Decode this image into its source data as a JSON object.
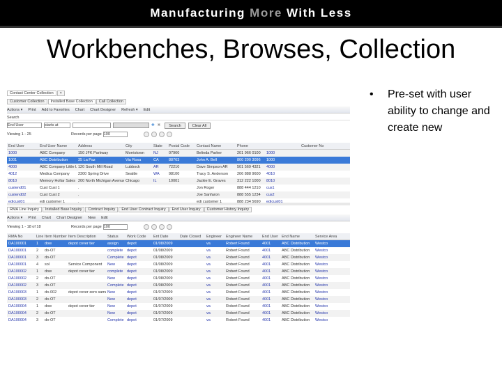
{
  "banner": {
    "part1": "Manufacturing ",
    "part2": "More",
    "part3": " With Less"
  },
  "title": "Workbenches, Browses, Collection",
  "bullet": "Pre-set with user ability to change and create new",
  "app": {
    "top_tab": "Contact Center Collection",
    "collection_tabs": [
      "Customer Collection",
      "Installed Base Collection",
      "Call Collection"
    ],
    "toolbar1": [
      "Actions ▾",
      "Print",
      "Add to Favorites",
      "Chart",
      "Chart Designer",
      "Refresh ▾",
      "Edit"
    ],
    "search_label": "Search",
    "search_field": "End User",
    "search_op": "starts at",
    "search_value": "",
    "search_button": "Search",
    "clear_button": "Clear All",
    "viewing1": "Viewing 1 - 25",
    "records_label": "Records per page",
    "records_value1": "100",
    "grid1": {
      "columns": [
        "End User",
        "End User Name",
        "Address",
        "City",
        "State",
        "Postal Code",
        "Contact Name",
        "Phone",
        "",
        "Customer No"
      ],
      "link_cols": [
        0,
        4,
        8
      ],
      "selected": 1,
      "rows": [
        [
          "1000",
          "ABC Company",
          "150 JFK Parkway",
          "Morristown",
          "NJ",
          "07960",
          "Belinda Parker",
          "201 966 0100",
          "1000",
          ""
        ],
        [
          "1001",
          "ABC Distribution",
          "35 La Paz",
          "Via Rosa",
          "CA",
          "88763",
          "John A. Bell",
          "800 200 3096",
          "1000",
          ""
        ],
        [
          "4000",
          "ABC Company Little Ltd.",
          "120 South Mill Road",
          "Lubbock",
          "AR",
          "72210",
          "Dave Simpson AR",
          "501 569 4321",
          "4000",
          ""
        ],
        [
          "4012",
          "Medica Company",
          "2300 Spring Drive",
          "Seattle",
          "WA",
          "98100",
          "Tracy S. Anderson",
          "206 888 9600",
          "4010",
          ""
        ],
        [
          "8010",
          "Memory Hollar Sales",
          "200 North Michigan Avenue",
          "Chicago",
          "IL",
          "10001",
          "Jackie E. Graves",
          "312 222 1000",
          "8010",
          ""
        ],
        [
          "custend01",
          "Cust Cust 1",
          ".",
          "",
          "",
          "",
          "Jon Roger",
          "888 444 1210",
          "cus1",
          ""
        ],
        [
          "custend02",
          "Cust Cust 2",
          ".",
          "",
          "",
          "",
          "Joe Sanfaron",
          "888 555 1234",
          "cus2",
          ""
        ],
        [
          "edicust01",
          "edi customer 1",
          ".",
          "",
          "",
          "",
          "edi customer 1",
          "888 234 5690",
          "edicust01",
          ""
        ]
      ]
    },
    "bottom_tabs": [
      "RMA Line Inquiry",
      "Installed Base Inquiry",
      "Contract Inquiry",
      "End User Contract Inquiry",
      "End User Inquiry",
      "Customer History Inquiry"
    ],
    "toolbar2": [
      "Actions ▾",
      "Print",
      "Chart",
      "Chart Designer",
      "New",
      "Edit"
    ],
    "viewing2": "Viewing 1 - 18 of 18",
    "records_value2": "100",
    "grid2": {
      "columns": [
        "RMA No",
        "Line",
        "Item Number",
        "Item Description",
        "Status",
        "Work Code",
        "Ent Date",
        "Date Closed",
        "Engineer",
        "Engineer Name",
        "End User",
        "End Name",
        "Service Area"
      ],
      "link_cols": [
        0,
        4,
        5,
        8,
        10,
        12
      ],
      "selected": 0,
      "rows": [
        [
          "DA100001",
          "1",
          "dow",
          "depot cover tier",
          "assign",
          "depot",
          "01/08/2009",
          "",
          "va",
          "Robert Found",
          "4001",
          "ABC Distribution",
          "Westco"
        ],
        [
          "DA100001",
          "2",
          "do-OT",
          "",
          "complete",
          "depot",
          "01/08/2009",
          "",
          "va",
          "Robert Found",
          "4001",
          "ABC Distribution",
          "Westco"
        ],
        [
          "DA100001",
          "3",
          "do-OT",
          "",
          "Complete",
          "depot",
          "01/08/2009",
          "",
          "va",
          "Robert Found",
          "4001",
          "ABC Distribution",
          "Westco"
        ],
        [
          "DA100001",
          "4",
          "sol",
          "Service Component",
          "New",
          "depot",
          "01/08/2009",
          "",
          "va",
          "Robert Found",
          "4001",
          "ABC Distribution",
          "Westco"
        ],
        [
          "DA100002",
          "1",
          "dow",
          "depot cover tier",
          "complete",
          "depot",
          "01/08/2009",
          "",
          "va",
          "Robert Found",
          "4001",
          "ABC Distribution",
          "Westco"
        ],
        [
          "DA100002",
          "2",
          "do-OT",
          "",
          "New",
          "depot",
          "01/08/2009",
          "",
          "va",
          "Robert Found",
          "4001",
          "ABC Distribution",
          "Westco"
        ],
        [
          "DA100002",
          "3",
          "do-OT",
          "",
          "Complete",
          "depot",
          "01/08/2009",
          "",
          "va",
          "Robert Found",
          "4001",
          "ABC Distribution",
          "Westco"
        ],
        [
          "DA100003",
          "1",
          "do-002",
          "depot cover zero same",
          "New",
          "depot",
          "01/07/2009",
          "",
          "va",
          "Robert Found",
          "4001",
          "ABC Distribution",
          "Westco"
        ],
        [
          "DA100003",
          "2",
          "do-OT",
          "",
          "New",
          "depot",
          "01/07/2009",
          "",
          "va",
          "Robert Found",
          "4001",
          "ABC Distribution",
          "Westco"
        ],
        [
          "DA100004",
          "1",
          "dow",
          "depot cover tier",
          "New",
          "depot",
          "01/07/2009",
          "",
          "va",
          "Robert Found",
          "4001",
          "ABC Distribution",
          "Westco"
        ],
        [
          "DA100004",
          "2",
          "do-OT",
          "",
          "New",
          "depot",
          "01/07/2009",
          "",
          "va",
          "Robert Found",
          "4001",
          "ABC Distribution",
          "Westco"
        ],
        [
          "DA100004",
          "3",
          "do-OT",
          "",
          "Complete",
          "depot",
          "01/07/2009",
          "",
          "va",
          "Robert Found",
          "4001",
          "ABC Distribution",
          "Westco"
        ]
      ]
    }
  }
}
